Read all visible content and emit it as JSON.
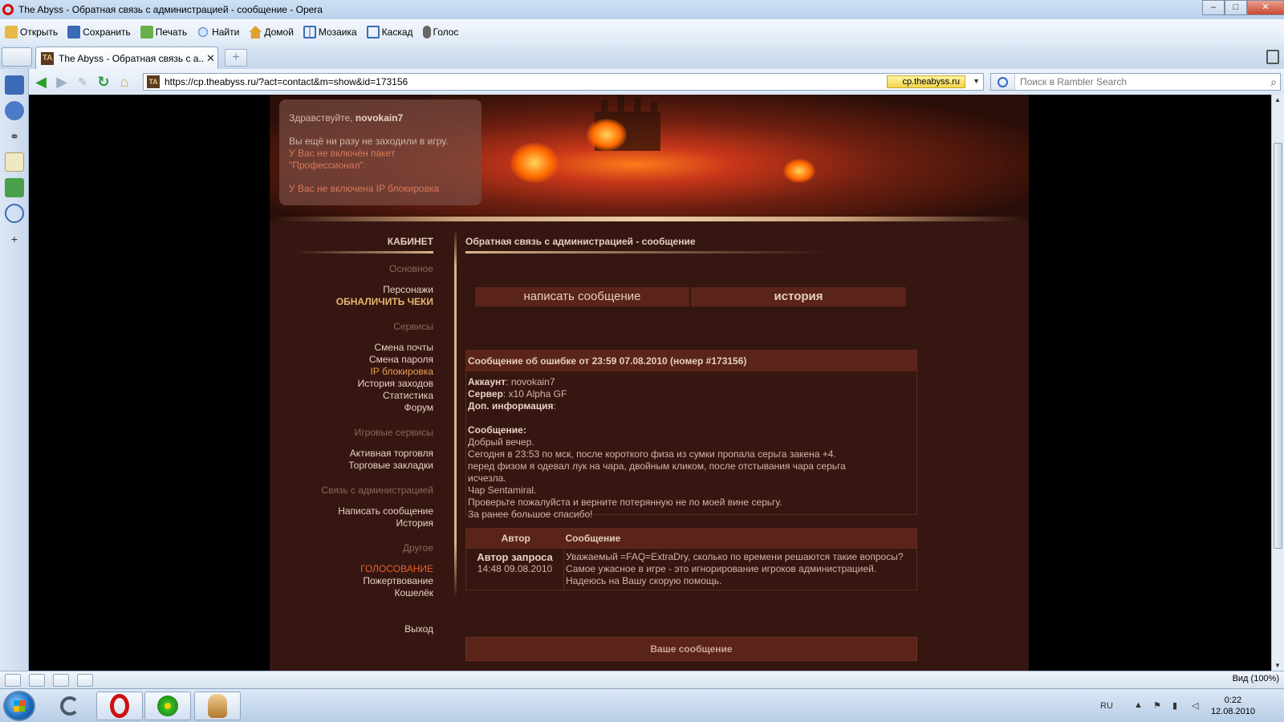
{
  "window": {
    "title": "The Abyss - Обратная связь с администрацией - сообщение - Opera",
    "minimize": "–",
    "maximize": "□",
    "close": "✕"
  },
  "toolbar": {
    "items": [
      "Открыть",
      "Сохранить",
      "Печать",
      "Найти",
      "Домой",
      "Мозаика",
      "Каскад",
      "Голос"
    ]
  },
  "tab": {
    "title": "The Abyss - Обратная связь с а...",
    "close": "✕",
    "new_tab": "+"
  },
  "address": {
    "url": "https://cp.theabyss.ru/?act=contact&m=show&id=173156",
    "secure_domain": "cp.theabyss.ru",
    "favicon": "TA"
  },
  "search": {
    "placeholder": "Поиск в Rambler Search"
  },
  "greeting": {
    "hello": "Здравствуйте,",
    "username": "novokain7",
    "line1": "Вы ещё ни разу не заходили в игру.",
    "line2": "У Вас не включён пакет \"Профессионал\".",
    "line3": "У Вас не включена IP блокировка"
  },
  "menu": {
    "title": "КАБИНЕТ",
    "sections": [
      {
        "name": "Основное",
        "links": [
          "Персонажи",
          "ОБНАЛИЧИТЬ ЧЕКИ"
        ]
      },
      {
        "name": "Сервисы",
        "links": [
          "Смена почты",
          "Смена пароля",
          "IP блокировка",
          "История заходов",
          "Статистика",
          "Форум"
        ]
      },
      {
        "name": "Игровые сервисы",
        "links": [
          "Активная торговля",
          "Торговые закладки"
        ]
      },
      {
        "name": "Связь с администрацией",
        "links": [
          "Написать сообщение",
          "История"
        ]
      },
      {
        "name": "Другое",
        "links": [
          "ГОЛОСОВАНИЕ",
          "Пожертвование",
          "Кошелёк"
        ]
      }
    ],
    "logout": "Выход"
  },
  "main": {
    "page_title": "Обратная связь с администрацией - сообщение",
    "btn_write": "написать сообщение",
    "btn_history": "история",
    "message": {
      "header": "Сообщение об ошибке от 23:59 07.08.2010 (номер #173156)",
      "account_label": "Аккаунт",
      "account": ": novokain7",
      "server_label": "Сервер",
      "server": ": x10 Alpha GF",
      "info_label": "Доп. информация",
      "info": ":",
      "msg_label": "Сообщение:",
      "lines": [
        "Добрый вечер.",
        "Сегодня в 23:53 по мск, после короткого физа из сумки пропала серьга закена +4.",
        "перед физом я одевал лук на чара, двойным кликом, после отстывания чара серьга",
        "исчезла.",
        "Чар Sentamiral.",
        "Проверьте пожалуйста и верните потерянную не по моей вине серьгу.",
        "За ранее большое спасибо!"
      ]
    },
    "reply_table": {
      "col_author": "Автор",
      "col_message": "Сообщение",
      "author": "Автор запроса",
      "time": "14:48 09.08.2010",
      "lines": [
        "Уважаемый =FAQ=ExtraDry, сколько по времени решаются такие вопросы?",
        "Самое ужасное в игре - это игнорирование игроков администрацией.",
        "Надеюсь на Вашу скорую помощь."
      ]
    },
    "your_message": "Ваше сообщение"
  },
  "statusbar": {
    "zoom": "Вид (100%)"
  },
  "taskbar": {
    "lang": "RU",
    "time": "0:22",
    "date": "12.08.2010"
  },
  "colors": {
    "site_bg": "#351611",
    "header_bg": "#5a2418",
    "accent_gold": "#e8b870",
    "accent_red": "#d77a5a"
  }
}
